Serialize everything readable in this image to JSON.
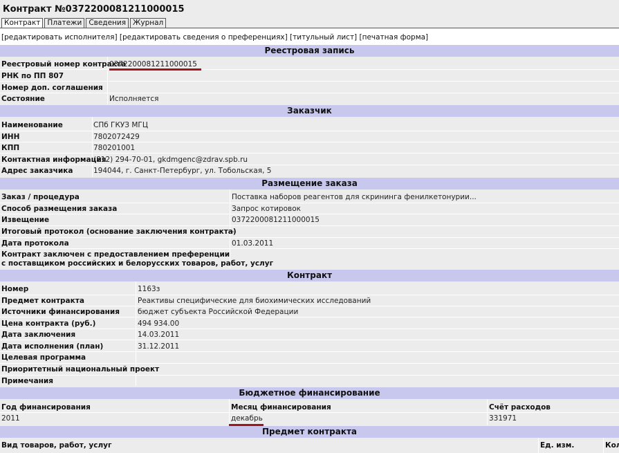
{
  "page_title": "Контракт №0372200081211000015",
  "tabs": [
    "Контракт",
    "Платежи",
    "Сведения",
    "Журнал"
  ],
  "links": [
    "[редактировать исполнителя]",
    "[редактировать сведения о преференциях]",
    "[титульный лист]",
    "[печатная форма]"
  ],
  "registry": {
    "header": "Реестровая запись",
    "rows": [
      {
        "label": "Реестровый номер контракта",
        "value": "0372200081211000015"
      },
      {
        "label": "РНК по ПП 807",
        "value": ""
      },
      {
        "label": "Номер доп. соглашения",
        "value": ""
      },
      {
        "label": "Состояние",
        "value": "Исполняется"
      }
    ]
  },
  "customer": {
    "header": "Заказчик",
    "rows": [
      {
        "label": "Наименование",
        "value": "СПб ГКУЗ МГЦ"
      },
      {
        "label": "ИНН",
        "value": "7802072429"
      },
      {
        "label": "КПП",
        "value": "780201001"
      },
      {
        "label": "Контактная информация",
        "value": "(812) 294-70-01, gkdmgenc@zdrav.spb.ru"
      },
      {
        "label": "Адрес заказчика",
        "value": "194044, г. Санкт-Петербург, ул. Тобольская, 5"
      }
    ]
  },
  "order": {
    "header": "Размещение заказа",
    "rows": [
      {
        "label": "Заказ / процедура",
        "value": "Поставка наборов реагентов для скрининга фенилкетонурии..."
      },
      {
        "label": "Способ размещения заказа",
        "value": "Запрос котировок"
      },
      {
        "label": "Извещение",
        "value": "0372200081211000015"
      },
      {
        "label": "Итоговый протокол (основание заключения контракта)",
        "value": "-"
      },
      {
        "label": "Дата протокола",
        "value": "01.03.2011"
      }
    ],
    "pref_label_1": "Контракт заключен с предоставлением преференции",
    "pref_label_2": "с поставщиком российских и белорусских товаров, работ, услуг",
    "pref_value": ""
  },
  "contract": {
    "header": "Контракт",
    "rows": [
      {
        "label": "Номер",
        "value": "1163з"
      },
      {
        "label": "Предмет контракта",
        "value": "Реактивы специфические для биохимических исследований"
      },
      {
        "label": "Источники финансирования",
        "value": "бюджет субъекта Российской Федерации"
      },
      {
        "label": "Цена контракта (руб.)",
        "value": "494 934.00"
      },
      {
        "label": "Дата заключения",
        "value": "14.03.2011"
      },
      {
        "label": "Дата исполнения (план)",
        "value": "31.12.2011"
      },
      {
        "label": "Целевая программа",
        "value": ""
      },
      {
        "label": "Приоритетный национальный проект",
        "value": ""
      },
      {
        "label": "Примечания",
        "value": ""
      }
    ]
  },
  "budget": {
    "header": "Бюджетное финансирование",
    "col_year": "Год финансирования",
    "col_month": "Месяц финансирования",
    "col_account": "Счёт расходов",
    "year": "2011",
    "month": "декабрь",
    "account": "331971"
  },
  "subject": {
    "header": "Предмет контракта",
    "col_kind": "Вид товаров, работ, услуг",
    "col_unit": "Ед. изм.",
    "col_qty": "Кол"
  },
  "colors": {
    "header_bg": "#c8c8ee",
    "underline": "#a0141c",
    "page_bg": "#ececec"
  }
}
